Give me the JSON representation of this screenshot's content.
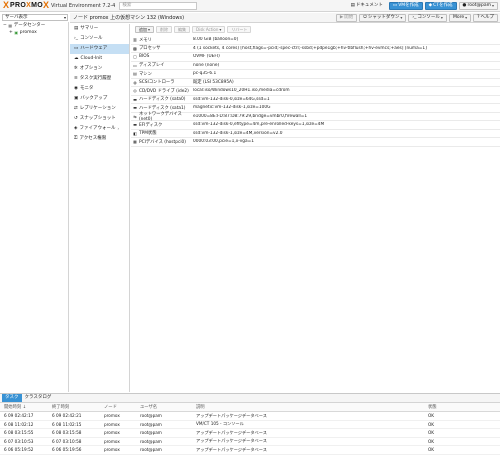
{
  "app": {
    "logo_x": "X",
    "logo_word_pre": "PRO",
    "logo_word_x": "X",
    "logo_word_post": "MO",
    "logo_x2": "X",
    "version": "Virtual Environment 7.2-4",
    "search_placeholder": "検索"
  },
  "topbar": {
    "docs": "ドキュメント",
    "create_vm": "VMを作成",
    "create_ct": "CTを作成",
    "user": "root@pam"
  },
  "view": {
    "label": "サーバ表示"
  },
  "tree": [
    {
      "label": "データセンター",
      "level": 0
    },
    {
      "label": "promox",
      "level": 1
    }
  ],
  "content": {
    "title": "ノード promox 上の仮想マシン 132 (Windows)",
    "start": "開始",
    "shutdown": "シャットダウン",
    "console": "コンソール",
    "more": "More",
    "help": "ヘルプ"
  },
  "nav": [
    {
      "label": "サマリー",
      "icon": "summary-icon"
    },
    {
      "label": "コンソール",
      "icon": "console-icon"
    },
    {
      "label": "ハードウェア",
      "icon": "hardware-icon",
      "active": true
    },
    {
      "label": "Cloud-Init",
      "icon": "cloud-icon"
    },
    {
      "label": "オプション",
      "icon": "gear-icon"
    },
    {
      "label": "タスク実行履歴",
      "icon": "list-icon"
    },
    {
      "label": "モニタ",
      "icon": "eye-icon"
    },
    {
      "label": "バックアップ",
      "icon": "floppy-icon"
    },
    {
      "label": "レプリケーション",
      "icon": "retweet-icon"
    },
    {
      "label": "スナップショット",
      "icon": "history-icon"
    },
    {
      "label": "ファイアウォール",
      "icon": "shield-icon"
    },
    {
      "label": "アクセス権限",
      "icon": "unlock-icon"
    }
  ],
  "toolbar": {
    "add": "追加",
    "remove": "削除",
    "edit": "編集",
    "disk_action": "Disk Action",
    "revert": "リバート"
  },
  "hardware": [
    {
      "name": "メモリ",
      "value": "8.00 GiB [balloon=0]",
      "icon": "memory-icon"
    },
    {
      "name": "プロセッサ",
      "value": "4 (1 sockets, 4 cores) [host,flags=-pcid;-spec-ctrl;-ssbd;+pdpe1gb;+hv-tlbflush;+hv-evmcs;+aes] [numa=1]",
      "icon": "cpu-icon"
    },
    {
      "name": "BIOS",
      "value": "OVMF (UEFI)",
      "icon": "bios-icon"
    },
    {
      "name": "ディスプレイ",
      "value": "none (none)",
      "icon": "display-icon"
    },
    {
      "name": "マシン",
      "value": "pc-q35-6.1",
      "icon": "machine-icon"
    },
    {
      "name": "SCSIコントローラ",
      "value": "既定 (LSI 53C895A)",
      "icon": "database-icon"
    },
    {
      "name": "CD/DVD ドライブ (ide2)",
      "value": "local:iso/Windows10_20H1.iso,media=cdrom",
      "icon": "cdrom-icon"
    },
    {
      "name": "ハードディスク (sata0)",
      "value": "ssd:vm-132-disk-0,size=64G,ssd=1",
      "icon": "hdd-icon"
    },
    {
      "name": "ハードディスク (sata1)",
      "value": "magnetic:vm-132-disk-1,size=100G",
      "icon": "hdd-icon"
    },
    {
      "name": "ネットワークデバイス (net0)",
      "value": "e1000=8E:FD:87:D8:79:29,bridge=vmbr0,firewall=1",
      "icon": "network-icon"
    },
    {
      "name": "EFIディスク",
      "value": "ssd:vm-132-disk-0,efitype=4m,pre-enrolled-keys=1,size=4M",
      "icon": "hdd-icon"
    },
    {
      "name": "TPM状態",
      "value": "ssd:vm-132-disk-1,size=4M,version=v2.0",
      "icon": "tpm-icon"
    },
    {
      "name": "PCIデバイス (hostpci0)",
      "value": "0000:03:00,pcie=1,x-vga=1",
      "icon": "pci-icon"
    }
  ],
  "bottom": {
    "tab_tasks": "タスク",
    "tab_cluster": "クラスタログ"
  },
  "tasks": {
    "headers": [
      "開始時刻",
      "終了時刻",
      "ノード",
      "ユーザ名",
      "説明",
      "状態"
    ],
    "rows": [
      [
        "6 09 02:42:17",
        "6 09 02:42:21",
        "promox",
        "root@pam",
        "アップデートパッケージデータベース",
        "OK"
      ],
      [
        "6 08 11:02:12",
        "6 08 11:02:15",
        "promox",
        "root@pam",
        "VM/CT 105 - コンソール",
        "OK"
      ],
      [
        "6 08 03:15:55",
        "6 08 03:15:58",
        "promox",
        "root@pam",
        "アップデートパッケージデータベース",
        "OK"
      ],
      [
        "6 07 03:10:53",
        "6 07 03:10:58",
        "promox",
        "root@pam",
        "アップデートパッケージデータベース",
        "OK"
      ],
      [
        "6 06 05:19:52",
        "6 06 05:19:56",
        "promox",
        "root@pam",
        "アップデートパッケージデータベース",
        "OK"
      ]
    ]
  }
}
